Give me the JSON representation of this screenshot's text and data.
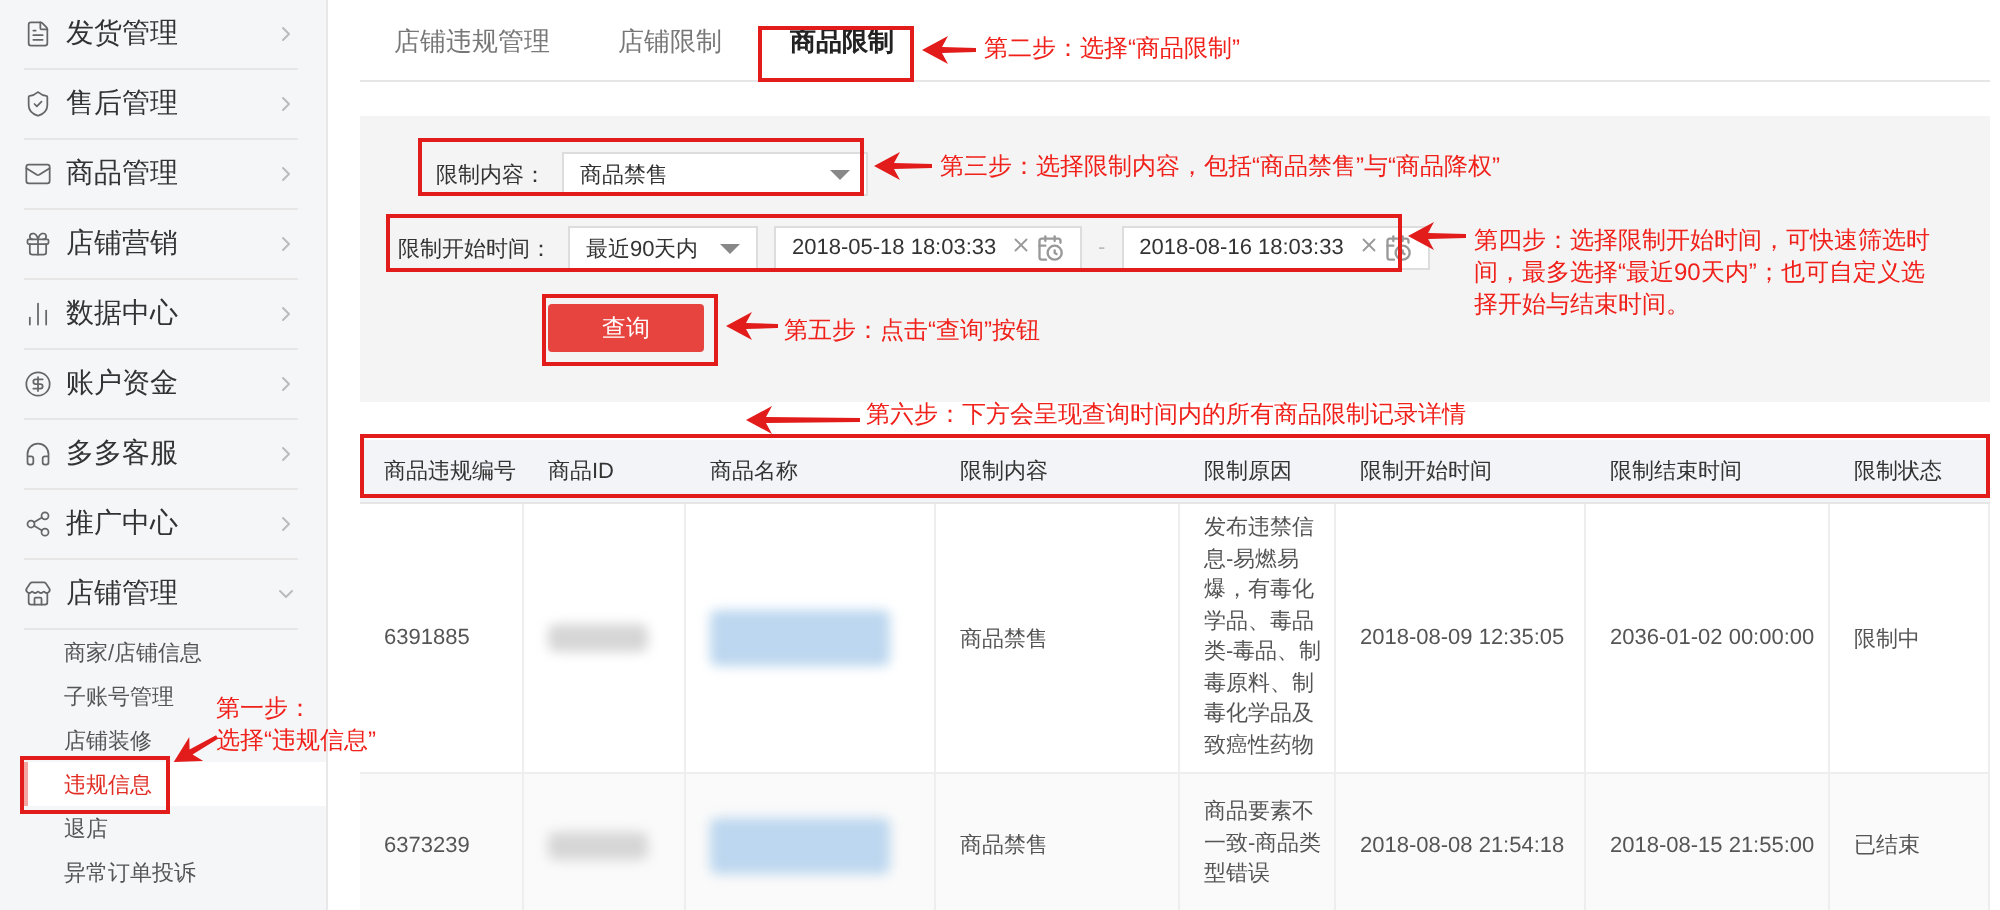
{
  "sidebar": {
    "items": [
      {
        "label": "发货管理",
        "expanded": false
      },
      {
        "label": "售后管理",
        "expanded": false
      },
      {
        "label": "商品管理",
        "expanded": false
      },
      {
        "label": "店铺营销",
        "expanded": false
      },
      {
        "label": "数据中心",
        "expanded": false
      },
      {
        "label": "账户资金",
        "expanded": false
      },
      {
        "label": "多多客服",
        "expanded": false
      },
      {
        "label": "推广中心",
        "expanded": false
      },
      {
        "label": "店铺管理",
        "expanded": true,
        "children": [
          {
            "label": "商家/店铺信息",
            "selected": false
          },
          {
            "label": "子账号管理",
            "selected": false
          },
          {
            "label": "店铺装修",
            "selected": false
          },
          {
            "label": "违规信息",
            "selected": true
          },
          {
            "label": "退店",
            "selected": false
          },
          {
            "label": "异常订单投诉",
            "selected": false
          }
        ]
      }
    ]
  },
  "tabs": [
    {
      "label": "店铺违规管理",
      "selected": false
    },
    {
      "label": "店铺限制",
      "selected": false
    },
    {
      "label": "商品限制",
      "selected": true
    }
  ],
  "filters": {
    "content": {
      "label": "限制内容：",
      "value": "商品禁售"
    },
    "time": {
      "label": "限制开始时间：",
      "value": "最近90天内",
      "start": "2018-05-18 18:03:33",
      "separator": "-",
      "end": "2018-08-16 18:03:33"
    },
    "button": "查询"
  },
  "table": {
    "columns": [
      "商品违规编号",
      "商品ID",
      "商品名称",
      "限制内容",
      "限制原因",
      "限制开始时间",
      "限制结束时间",
      "限制状态"
    ],
    "rows": [
      {
        "cells": [
          {
            "kind": "text",
            "text": "6391885"
          },
          {
            "kind": "blurred"
          },
          {
            "kind": "blurred-link"
          },
          {
            "kind": "text",
            "text": "商品禁售"
          },
          {
            "kind": "text",
            "text": "发布违禁信息-易燃易爆，有毒化学品、毒品类-毒品、制毒原料、制毒化学品及致癌性药物"
          },
          {
            "kind": "text",
            "text": "2018-08-09 12:35:05"
          },
          {
            "kind": "text",
            "text": "2036-01-02 00:00:00"
          },
          {
            "kind": "text",
            "text": "限制中"
          }
        ]
      },
      {
        "cells": [
          {
            "kind": "text",
            "text": "6373239"
          },
          {
            "kind": "blurred"
          },
          {
            "kind": "blurred-link"
          },
          {
            "kind": "text",
            "text": "商品禁售"
          },
          {
            "kind": "text",
            "text": "商品要素不一致-商品类型错误"
          },
          {
            "kind": "text",
            "text": "2018-08-08 21:54:18"
          },
          {
            "kind": "text",
            "text": "2018-08-15 21:55:00"
          },
          {
            "kind": "text",
            "text": "已结束"
          }
        ]
      }
    ]
  },
  "annotations": [
    {
      "lines": [
        "第一步：",
        "选择“违规信息”"
      ]
    },
    {
      "lines": [
        "第二步：选择“商品限制”"
      ]
    },
    {
      "lines": [
        "第三步：选择限制内容，包括“商品禁售”与“商品降权”"
      ]
    },
    {
      "lines": [
        "第四步：选择限制开始时间，可快速筛选时",
        "间，最多选择“最近90天内”；也可自定义选",
        "择开始与结束时间。"
      ]
    },
    {
      "lines": [
        "第五步：点击“查询”按钮"
      ]
    },
    {
      "lines": [
        "第六步：下方会呈现查询时间内的所有商品限制记录详情"
      ]
    }
  ]
}
